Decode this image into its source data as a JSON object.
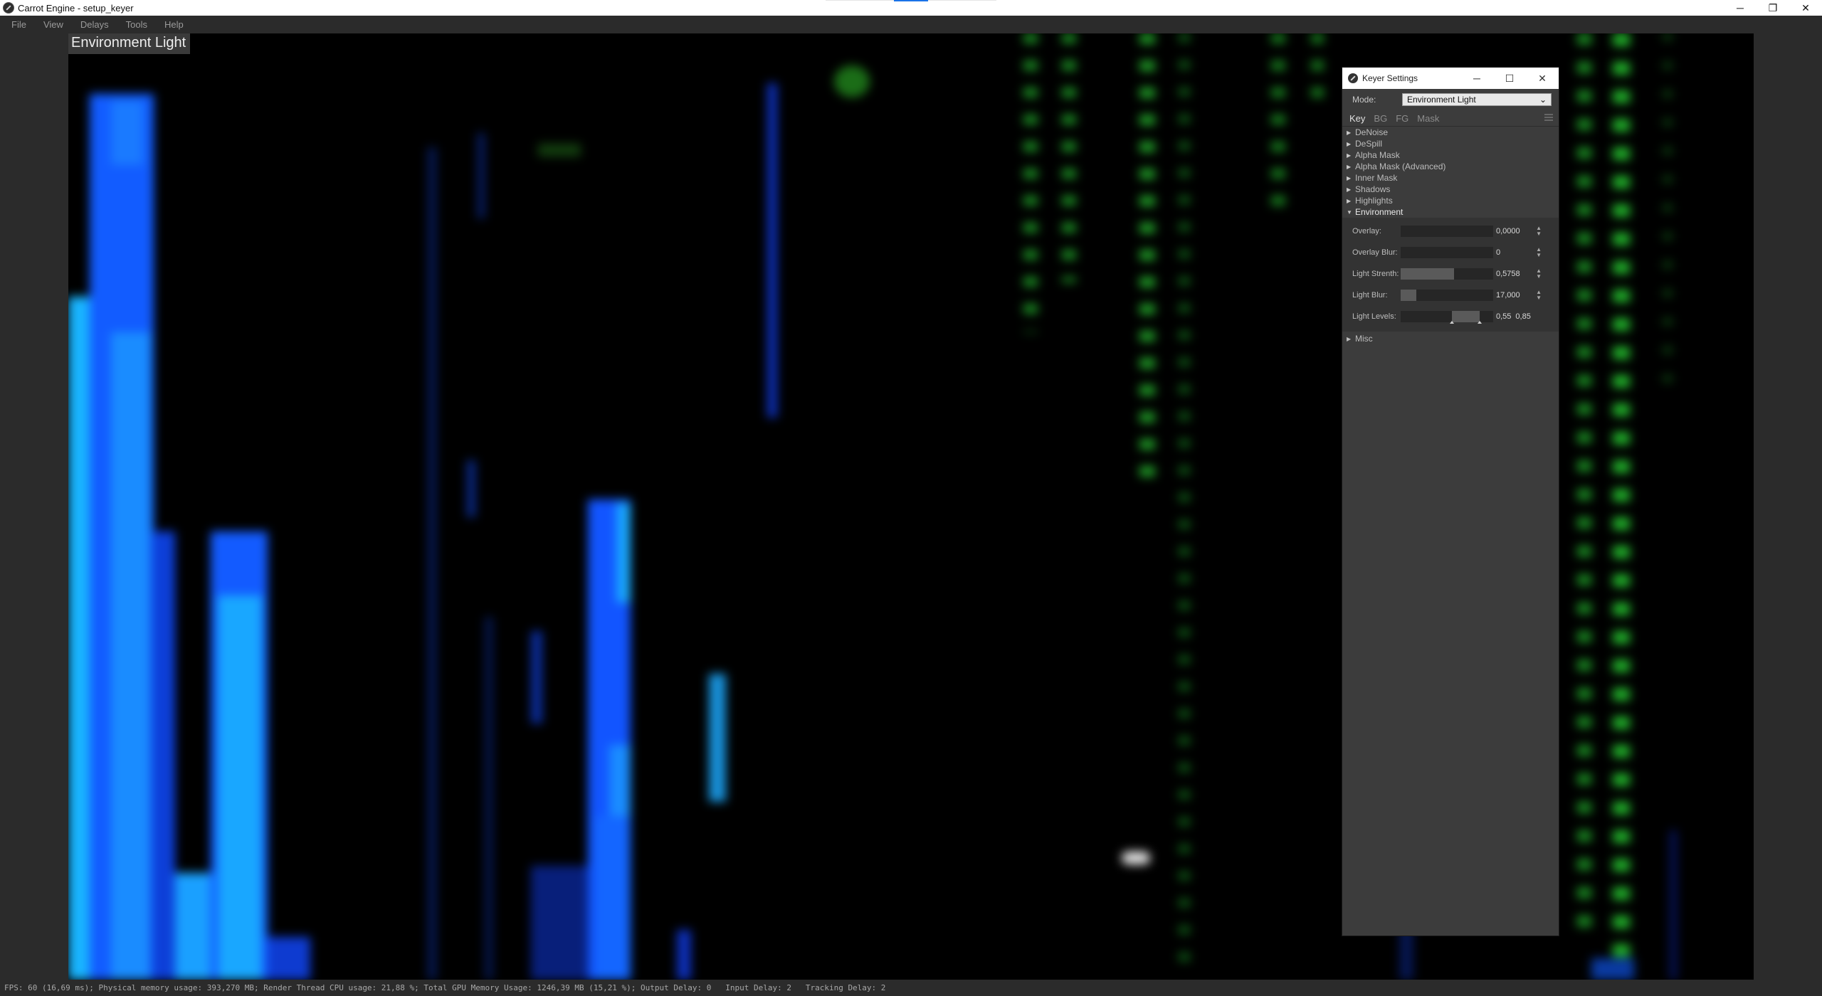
{
  "window": {
    "title": "Carrot Engine - setup_keyer",
    "controls": {
      "minimize": "─",
      "restore": "❐",
      "close": "✕"
    }
  },
  "menu": [
    "File",
    "View",
    "Delays",
    "Tools",
    "Help"
  ],
  "viewport": {
    "title": "Environment Light"
  },
  "statusbar": {
    "text": "FPS: 60 (16,69 ms); Physical memory usage: 393,270 MB; Render Thread CPU usage: 21,88 %; Total GPU Memory Usage: 1246,39 MB (15,21 %); Output Delay: 0   Input Delay: 2   Tracking Delay: 2"
  },
  "keyer": {
    "title": "Keyer Settings",
    "controls": {
      "minimize": "─",
      "maximize": "☐",
      "close": "✕"
    },
    "mode_label": "Mode:",
    "mode_value": "Environment Light",
    "tabs": [
      "Key",
      "BG",
      "FG",
      "Mask"
    ],
    "sections": [
      "DeNoise",
      "DeSpill",
      "Alpha Mask",
      "Alpha Mask (Advanced)",
      "Inner Mask",
      "Shadows",
      "Highlights"
    ],
    "env_section": "Environment",
    "params": {
      "overlay": {
        "label": "Overlay:",
        "value": "0,0000",
        "level": 0.0
      },
      "overlay_blur": {
        "label": "Overlay Blur:",
        "value": "0",
        "level": 0.0
      },
      "light_strength": {
        "label": "Light Strenth:",
        "value": "0,5758",
        "level": 0.5758
      },
      "light_blur": {
        "label": "Light Blur:",
        "value": "17,000",
        "level": 0.17
      },
      "light_levels": {
        "label": "Light Levels:",
        "low": "0,55",
        "high": "0,85",
        "low_level": 0.55,
        "high_level": 0.85
      }
    },
    "misc_section": "Misc"
  },
  "colors": {
    "panel_bg": "#2b2b2b",
    "keyer_bg": "#3c3c3c",
    "blue_bright": "#19a7ff",
    "blue_deep": "#1246ff",
    "green_dot": "#1f8f2a"
  }
}
